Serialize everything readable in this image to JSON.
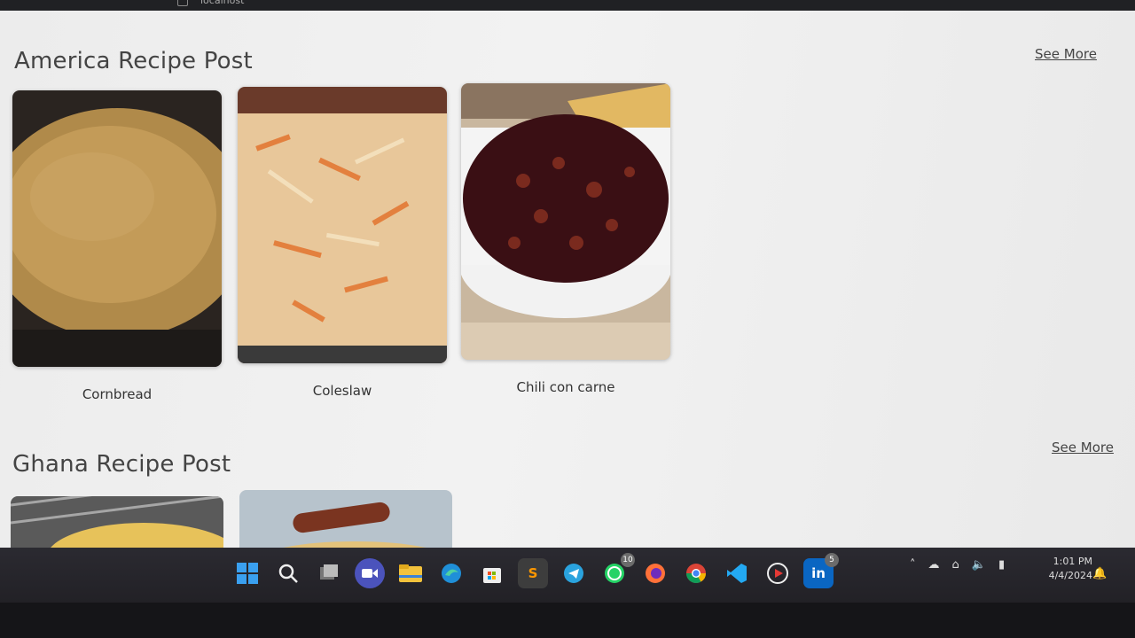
{
  "browser": {
    "url": "localhost"
  },
  "sections": [
    {
      "title": "America Recipe Post",
      "see_more": "See More",
      "recipes": [
        {
          "name": "Cornbread"
        },
        {
          "name": "Coleslaw"
        },
        {
          "name": "Chili con carne"
        }
      ]
    },
    {
      "title": "Ghana Recipe Post",
      "see_more": "See More"
    }
  ],
  "taskbar": {
    "apps": [
      {
        "icon": "windows-start-icon"
      },
      {
        "icon": "search-icon"
      },
      {
        "icon": "task-view-icon"
      },
      {
        "icon": "meet-icon"
      },
      {
        "icon": "file-explorer-icon"
      },
      {
        "icon": "edge-icon"
      },
      {
        "icon": "store-icon"
      },
      {
        "icon": "sublime-text-icon",
        "label": "S"
      },
      {
        "icon": "telegram-icon"
      },
      {
        "icon": "whatsapp-icon",
        "badge": "10"
      },
      {
        "icon": "firefox-icon"
      },
      {
        "icon": "chrome-icon"
      },
      {
        "icon": "vscode-icon"
      },
      {
        "icon": "media-player-icon"
      },
      {
        "icon": "linkedin-icon",
        "label": "in",
        "badge": "5"
      }
    ],
    "time": "1:01 PM",
    "date": "4/4/2024"
  }
}
